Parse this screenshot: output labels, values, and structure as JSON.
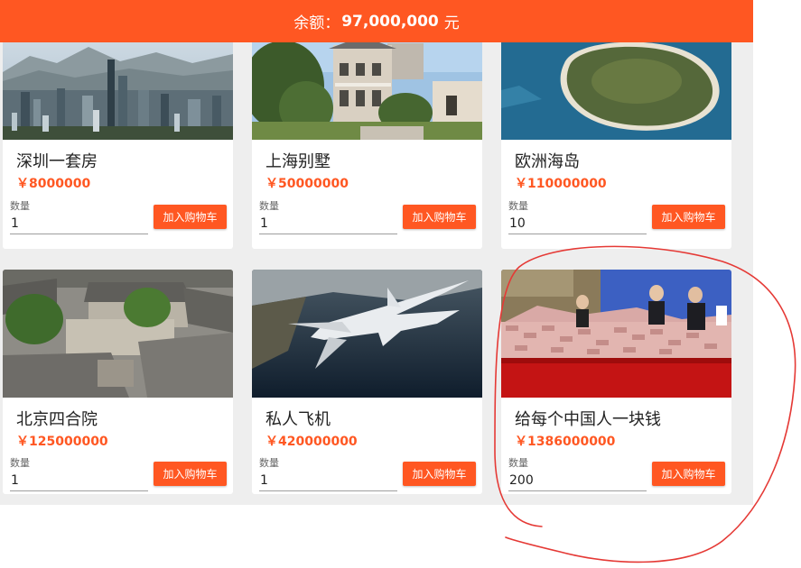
{
  "header": {
    "balance_label": "余额：",
    "balance_value": "97,000,000",
    "balance_unit": "元"
  },
  "quantity_label": "数量",
  "add_to_cart_label": "加入购物车",
  "products": [
    {
      "name": "深圳一套房",
      "price": "￥8000000",
      "quantity": "1"
    },
    {
      "name": "上海别墅",
      "price": "￥50000000",
      "quantity": "1"
    },
    {
      "name": "欧洲海岛",
      "price": "￥110000000",
      "quantity": "10"
    },
    {
      "name": "北京四合院",
      "price": "￥125000000",
      "quantity": "1"
    },
    {
      "name": "私人飞机",
      "price": "￥420000000",
      "quantity": "1"
    },
    {
      "name": "给每个中国人一块钱",
      "price": "￥1386000000",
      "quantity": "200"
    }
  ],
  "colors": {
    "accent": "#ff5722",
    "annotation": "#e53935"
  }
}
